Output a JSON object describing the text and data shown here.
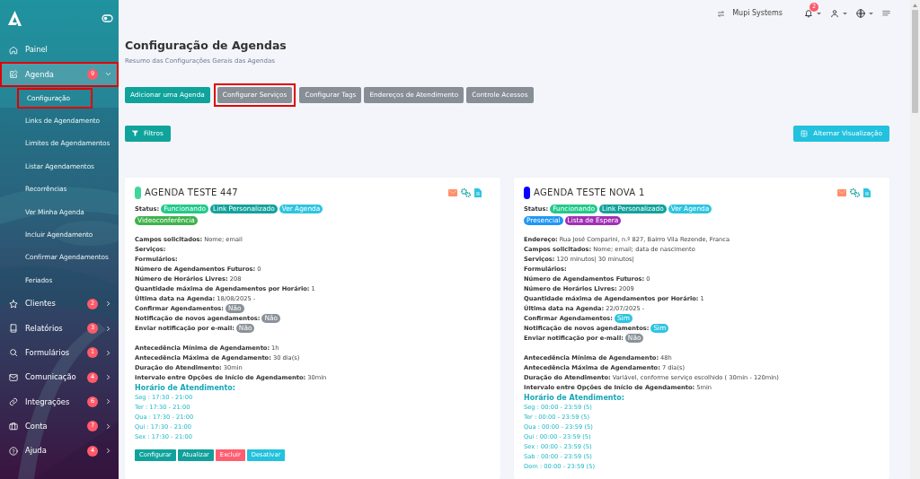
{
  "sidebar": {
    "items": [
      {
        "label": "Painel",
        "expanded": false,
        "selected": false,
        "highlighted": false
      },
      {
        "label": "Agenda",
        "badge": "9",
        "expanded": true,
        "selected": true,
        "highlighted": true,
        "children": [
          {
            "label": "Configuração",
            "selected": true,
            "highlighted": true
          },
          {
            "label": "Links de Agendamento",
            "selected": false,
            "highlighted": false
          },
          {
            "label": "Limites de Agendamentos",
            "selected": false,
            "highlighted": false
          },
          {
            "label": "Listar Agendamentos",
            "selected": false,
            "highlighted": false
          },
          {
            "label": "Recorrências",
            "selected": false,
            "highlighted": false
          },
          {
            "label": "Ver Minha Agenda",
            "selected": false,
            "highlighted": false
          },
          {
            "label": "Incluir Agendamento",
            "selected": false,
            "highlighted": false
          },
          {
            "label": "Confirmar Agendamentos",
            "selected": false,
            "highlighted": false
          },
          {
            "label": "Feriados",
            "selected": false,
            "highlighted": false
          }
        ]
      },
      {
        "label": "Clientes",
        "badge": "2",
        "expanded": false,
        "selected": false,
        "highlighted": false
      },
      {
        "label": "Relatórios",
        "badge": "3",
        "expanded": false,
        "selected": false,
        "highlighted": false
      },
      {
        "label": "Formulários",
        "badge": "1",
        "expanded": false,
        "selected": false,
        "highlighted": false
      },
      {
        "label": "Comunicação",
        "badge": "4",
        "expanded": false,
        "selected": false,
        "highlighted": false
      },
      {
        "label": "Integrações",
        "badge": "6",
        "expanded": false,
        "selected": false,
        "highlighted": false
      },
      {
        "label": "Conta",
        "badge": "7",
        "expanded": false,
        "selected": false,
        "highlighted": false
      },
      {
        "label": "Ajuda",
        "badge": "4",
        "expanded": false,
        "selected": false,
        "highlighted": false
      }
    ]
  },
  "header": {
    "company": "Mupi Systems",
    "notifications": "2"
  },
  "page": {
    "title": "Configuração de Agendas",
    "subtitle": "Resumo das Configurações Gerais das Agendas"
  },
  "actions": [
    {
      "label": "Adicionar uma Agenda",
      "color": "#0fa39b",
      "highlighted": false
    },
    {
      "label": "Configurar Serviços",
      "color": "#878e96",
      "highlighted": true
    },
    {
      "label": "Configurar Tags",
      "color": "#878e96",
      "highlighted": false
    },
    {
      "label": "Endereços de Atendimento",
      "color": "#878e96",
      "highlighted": false
    },
    {
      "label": "Controle Acessos",
      "color": "#878e96",
      "highlighted": false
    }
  ],
  "filter_button": "Filtros",
  "view_button": "Alternar Visualização",
  "cards": [
    {
      "title": "AGENDA TESTE 447",
      "color": "#3fd69a",
      "status_label": "Status:",
      "status": [
        {
          "text": "Funcionando",
          "color": "#22c98b"
        },
        {
          "text": "Link Personalizado",
          "color": "#12a29c"
        },
        {
          "text": "Ver Agenda",
          "color": "#2ec5e0"
        },
        {
          "text": "Videoconferência",
          "color": "#3fb24c"
        }
      ],
      "groups": [
        [
          {
            "label": "Campos solicitados:",
            "value": "Nome; email"
          },
          {
            "label": "Serviços:"
          },
          {
            "label": "Formulários:"
          },
          {
            "label": "Número de Agendamentos Futuros:",
            "value": "0"
          },
          {
            "label": "Número de Horários Livres:",
            "value": "208"
          },
          {
            "label": "Quantidade máxima de Agendamentos por Horário:",
            "value": "1"
          },
          {
            "label": "Última data na Agenda:",
            "value": "18/08/2025 -"
          },
          {
            "label": "Confirmar Agendamentos:",
            "badge": {
              "text": "Não",
              "color": "#8b9299"
            }
          },
          {
            "label": "Notificação de novos agendamentos:",
            "badge": {
              "text": "Não",
              "color": "#8b9299"
            }
          },
          {
            "label": "Enviar notificação por e-mail:",
            "badge": {
              "text": "Não",
              "color": "#8b9299"
            }
          }
        ],
        [
          {
            "label": "Antecedência Mínima de Agendamento:",
            "value": "1h"
          },
          {
            "label": "Antecedência Máxima de Agendamento:",
            "value": "30 dia(s)"
          },
          {
            "label": "Duração do Atendimento:",
            "value": "30min"
          },
          {
            "label": "Intervalo entre Opções de Início de Agendamento:",
            "value": "30min"
          }
        ]
      ],
      "schedule_title": "Horário de Atendimento:",
      "schedule": [
        "Seg : 17:30 - 21:00",
        "Ter : 17:30 - 21:00",
        "Qua : 17:30 - 21:00",
        "Qui : 17:30 - 21:00",
        "Sex : 17:30 - 21:00"
      ],
      "buttons": [
        {
          "label": "Configurar",
          "color": "#0fa39b"
        },
        {
          "label": "Atualizar",
          "color": "#11a09a"
        },
        {
          "label": "Excluir",
          "color": "#ff5d70"
        },
        {
          "label": "Desativar",
          "color": "#22c1de"
        }
      ]
    },
    {
      "title": "AGENDA TESTE NOVA 1",
      "color": "#0a00ff",
      "status_label": "Status:",
      "status": [
        {
          "text": "Funcionando",
          "color": "#22c98b"
        },
        {
          "text": "Link Personalizado",
          "color": "#12a29c"
        },
        {
          "text": "Ver Agenda",
          "color": "#2ec5e0"
        },
        {
          "text": "Presencial",
          "color": "#2196f3"
        },
        {
          "text": "Lista de Espera",
          "color": "#a02fb5"
        }
      ],
      "groups": [
        [
          {
            "label": "Endereço:",
            "value": "Rua José Comparini, n.º 827, Bairro Vila Rezende, Franca"
          },
          {
            "label": "Campos solicitados:",
            "value": "Nome; email; data de nascimento"
          },
          {
            "label": "Serviços:",
            "value": "120 minutos| 30 minutos|"
          },
          {
            "label": "Formulários:"
          },
          {
            "label": "Número de Agendamentos Futuros:",
            "value": "0"
          },
          {
            "label": "Número de Horários Livres:",
            "value": "2009"
          },
          {
            "label": "Quantidade máxima de Agendamentos por Horário:",
            "value": "1"
          },
          {
            "label": "Última data na Agenda:",
            "value": "22/07/2025 -"
          },
          {
            "label": "Confirmar Agendamentos:",
            "badge": {
              "text": "Sim",
              "color": "#2ec5e0"
            }
          },
          {
            "label": "Notificação de novos agendamentos:",
            "badge": {
              "text": "Sim",
              "color": "#2ec5e0"
            }
          },
          {
            "label": "Enviar notificação por e-mail:",
            "badge": {
              "text": "Não",
              "color": "#8b9299"
            }
          }
        ],
        [
          {
            "label": "Antecedência Mínima de Agendamento:",
            "value": "48h"
          },
          {
            "label": "Antecedência Máxima de Agendamento:",
            "value": "7 dia(s)"
          },
          {
            "label": "Duração do Atendimento:",
            "value": "Variável, conforme serviço escolhido ( 30min - 120min)"
          },
          {
            "label": "Intervalo entre Opções de Início de Agendamento:",
            "value": "5min"
          }
        ]
      ],
      "schedule_title": "Horário de Atendimento:",
      "schedule": [
        "Seg : 00:00 - 23:59 (5)",
        "Ter : 00:00 - 23:59 (5)",
        "Qua : 00:00 - 23:59 (5)",
        "Qui : 00:00 - 23:59 (5)",
        "Sex : 00:00 - 23:59 (5)",
        "Sab : 00:00 - 23:59 (5)",
        "Dom : 00:00 - 23:59 (5)"
      ]
    }
  ]
}
